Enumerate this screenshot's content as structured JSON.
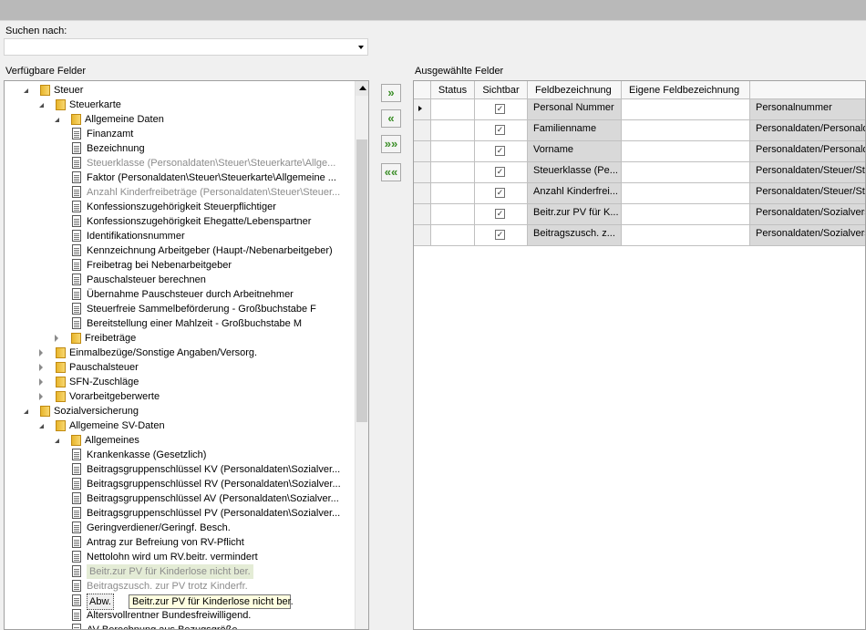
{
  "search": {
    "label": "Suchen nach:",
    "value": ""
  },
  "available_label": "Verfügbare Felder",
  "selected_label": "Ausgewählte Felder",
  "tree": [
    {
      "text": "Steuer",
      "kind": "folder",
      "level": 0,
      "state": "open"
    },
    {
      "text": "Steuerkarte",
      "kind": "folder",
      "level": 1,
      "state": "open"
    },
    {
      "text": "Allgemeine Daten",
      "kind": "folder",
      "level": 2,
      "state": "open"
    },
    {
      "text": "Finanzamt",
      "kind": "doc",
      "level": 3
    },
    {
      "text": "Bezeichnung",
      "kind": "doc",
      "level": 3
    },
    {
      "text": "Steuerklasse (Personaldaten\\Steuer\\Steuerkarte\\Allge...",
      "kind": "doc",
      "level": 3,
      "style": "grey"
    },
    {
      "text": "Faktor (Personaldaten\\Steuer\\Steuerkarte\\Allgemeine ...",
      "kind": "doc",
      "level": 3
    },
    {
      "text": "Anzahl Kinderfreibeträge (Personaldaten\\Steuer\\Steuer...",
      "kind": "doc",
      "level": 3,
      "style": "grey"
    },
    {
      "text": "Konfessionszugehörigkeit Steuerpflichtiger",
      "kind": "doc",
      "level": 3
    },
    {
      "text": "Konfessionszugehörigkeit Ehegatte/Lebenspartner",
      "kind": "doc",
      "level": 3
    },
    {
      "text": "Identifikationsnummer",
      "kind": "doc",
      "level": 3
    },
    {
      "text": "Kennzeichnung Arbeitgeber (Haupt-/Nebenarbeitgeber)",
      "kind": "doc",
      "level": 3
    },
    {
      "text": "Freibetrag bei Nebenarbeitgeber",
      "kind": "doc",
      "level": 3
    },
    {
      "text": "Pauschalsteuer berechnen",
      "kind": "doc",
      "level": 3
    },
    {
      "text": "Übernahme Pauschsteuer durch Arbeitnehmer",
      "kind": "doc",
      "level": 3
    },
    {
      "text": "Steuerfreie Sammelbeförderung - Großbuchstabe F",
      "kind": "doc",
      "level": 3
    },
    {
      "text": "Bereitstellung einer Mahlzeit - Großbuchstabe M",
      "kind": "doc",
      "level": 3
    },
    {
      "text": "Freibeträge",
      "kind": "folder",
      "level": 2,
      "state": "closed"
    },
    {
      "text": "Einmalbezüge/Sonstige Angaben/Versorg.",
      "kind": "folder",
      "level": 1,
      "state": "closed"
    },
    {
      "text": "Pauschalsteuer",
      "kind": "folder",
      "level": 1,
      "state": "closed"
    },
    {
      "text": "SFN-Zuschläge",
      "kind": "folder",
      "level": 1,
      "state": "closed"
    },
    {
      "text": "Vorarbeitgeberwerte",
      "kind": "folder",
      "level": 1,
      "state": "closed"
    },
    {
      "text": "Sozialversicherung",
      "kind": "folder",
      "level": 0,
      "state": "open"
    },
    {
      "text": "Allgemeine SV-Daten",
      "kind": "folder",
      "level": 1,
      "state": "open"
    },
    {
      "text": "Allgemeines",
      "kind": "folder",
      "level": 2,
      "state": "open"
    },
    {
      "text": "Krankenkasse (Gesetzlich)",
      "kind": "doc",
      "level": 3
    },
    {
      "text": "Beitragsgruppenschlüssel KV (Personaldaten\\Sozialver...",
      "kind": "doc",
      "level": 3
    },
    {
      "text": "Beitragsgruppenschlüssel RV (Personaldaten\\Sozialver...",
      "kind": "doc",
      "level": 3
    },
    {
      "text": "Beitragsgruppenschlüssel AV (Personaldaten\\Sozialver...",
      "kind": "doc",
      "level": 3
    },
    {
      "text": "Beitragsgruppenschlüssel PV (Personaldaten\\Sozialver...",
      "kind": "doc",
      "level": 3
    },
    {
      "text": "Geringverdiener/Geringf. Besch.",
      "kind": "doc",
      "level": 3
    },
    {
      "text": "Antrag zur Befreiung von RV-Pflicht",
      "kind": "doc",
      "level": 3
    },
    {
      "text": "Nettolohn wird um RV.beitr. vermindert",
      "kind": "doc",
      "level": 3
    },
    {
      "text": "Beitr.zur PV für Kinderlose nicht ber.",
      "kind": "doc",
      "level": 3,
      "style": "hl"
    },
    {
      "text": "Beitragszusch. zur PV trotz Kinderfr.",
      "kind": "doc",
      "level": 3,
      "style": "grey"
    },
    {
      "text": "Abw.",
      "kind": "doc",
      "level": 3,
      "style": "boxed"
    },
    {
      "text": "Altersvollrentner Bundesfreiwilligend.",
      "kind": "doc",
      "level": 3
    },
    {
      "text": "AV-Berechnung aus Bezugsgröße",
      "kind": "doc",
      "level": 3
    }
  ],
  "tooltip": "Beitr.zur PV für Kinderlose nicht ber.",
  "buttons": {
    "add": "»",
    "remove": "«",
    "add_all": "»»",
    "remove_all": "««"
  },
  "grid": {
    "columns": [
      "Status",
      "Sichtbar",
      "Feldbezeichnung",
      "Eigene Feldbezeichnung",
      ""
    ],
    "rows": [
      {
        "name": "Personal Nummer",
        "own": "",
        "path": "Personalnummer",
        "visible": true,
        "current": true
      },
      {
        "name": "Familienname",
        "own": "",
        "path": "Personaldaten/Personaldaten",
        "visible": true
      },
      {
        "name": "Vorname",
        "own": "",
        "path": "Personaldaten/Personaldaten",
        "visible": true
      },
      {
        "name": "Steuerklasse (Pe...",
        "own": "",
        "path": "Personaldaten/Steuer/Steuerkarte",
        "visible": true
      },
      {
        "name": "Anzahl Kinderfrei...",
        "own": "",
        "path": "Personaldaten/Steuer/Steuerkarte",
        "visible": true
      },
      {
        "name": "Beitr.zur PV für K...",
        "own": "",
        "path": "Personaldaten/Sozialversicherung",
        "visible": true
      },
      {
        "name": "Beitragszusch. z...",
        "own": "",
        "path": "Personaldaten/Sozialversicherung",
        "visible": true
      }
    ]
  }
}
